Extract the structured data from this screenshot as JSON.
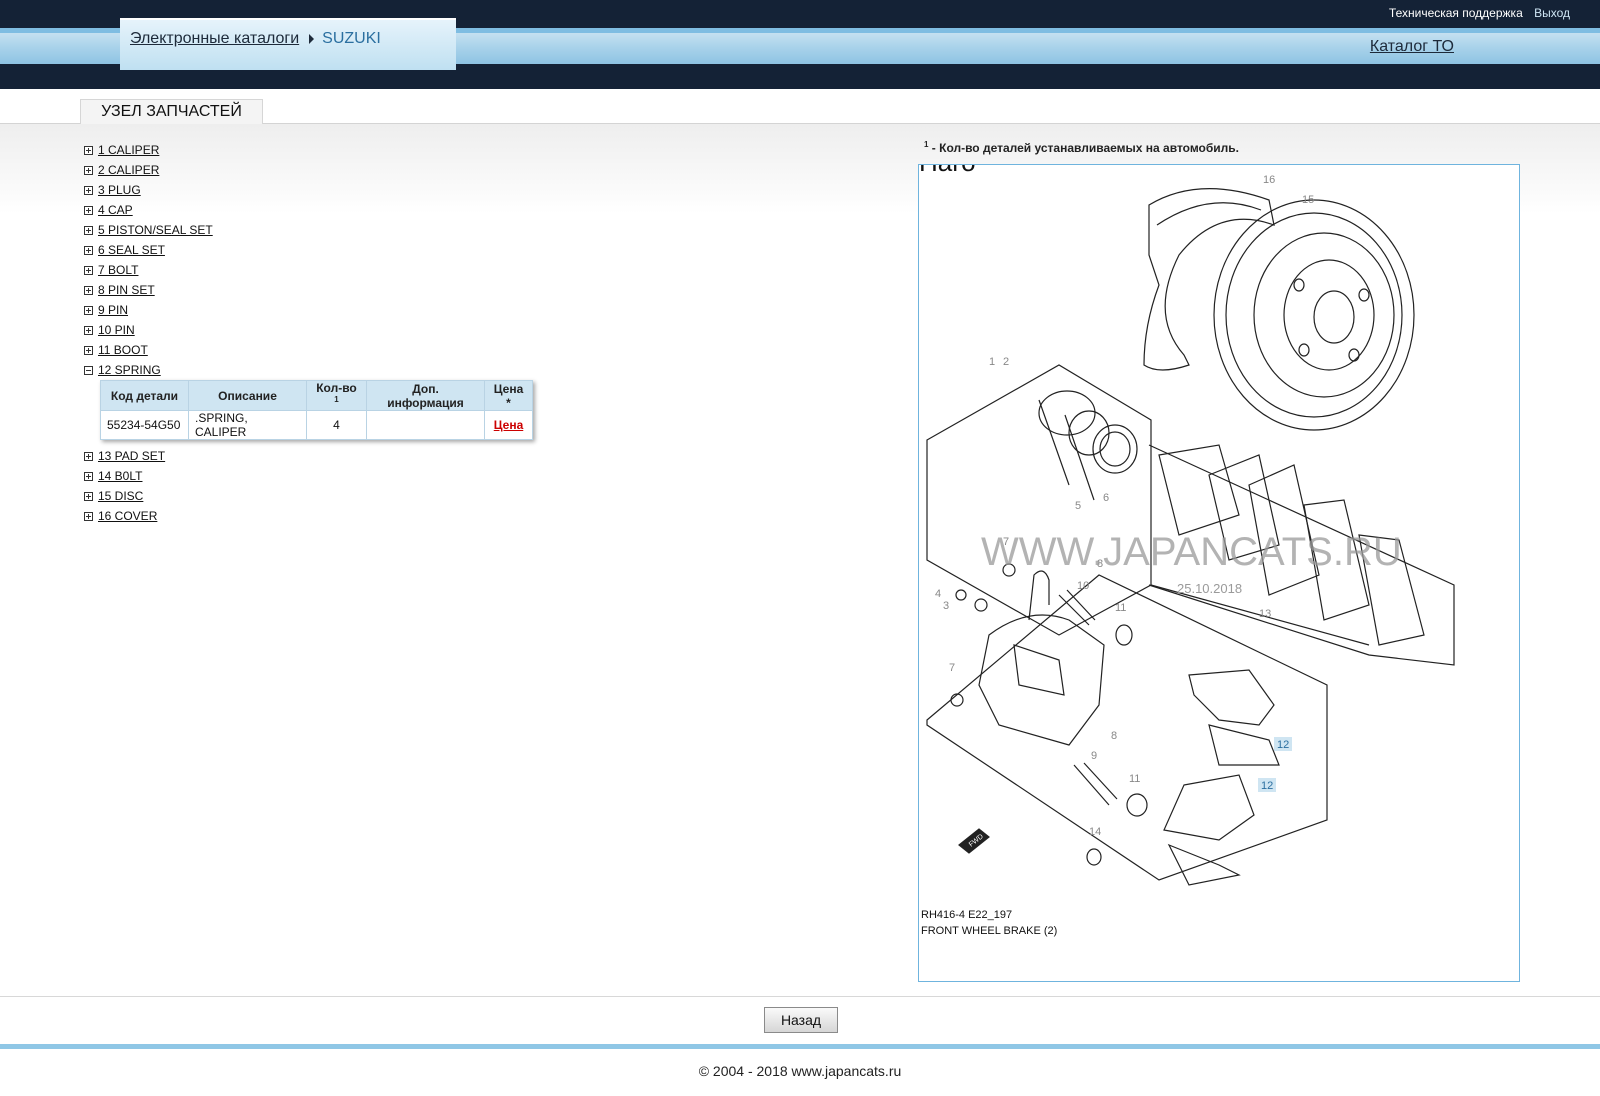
{
  "header": {
    "breadcrumb": {
      "catalogs": "Электронные каталоги",
      "brand": "SUZUKI"
    },
    "support": "Техническая поддержка",
    "exit": "Выход",
    "catalog_to": "Каталог ТО"
  },
  "tab": {
    "label": "УЗЕЛ ЗАПЧАСТЕЙ"
  },
  "tree": {
    "nodes": [
      "1 CALIPER",
      "2 CALIPER",
      "3 PLUG",
      "4 CAP",
      "5 PISTON/SEAL SET",
      "6 SEAL SET",
      "7 BOLT",
      "8 PIN SET",
      "9 PIN",
      "10 PIN",
      "11 BOOT",
      "12 SPRING",
      "13 PAD SET",
      "14 B0LT",
      "15 DISC",
      "16 COVER"
    ],
    "expanded_index": 11
  },
  "detail_table": {
    "headers": {
      "code": "Код детали",
      "desc": "Описание",
      "qty": "Кол-во",
      "qty_sup": "1",
      "info": "Доп. информация",
      "price": "Цена *"
    },
    "row": {
      "code": "55234-54G50",
      "desc": ".SPRING, CALIPER",
      "qty": "4",
      "info": "",
      "price": "Цена"
    }
  },
  "note": {
    "sup": "1",
    "text": " - Кол-во деталей устанавливаемых на автомобиль."
  },
  "diagram": {
    "title_partial": "Наго",
    "watermark": "WWW.JAPANCATS.RU",
    "date": "25.10.2018",
    "caption_code": "RH416-4 E22_197",
    "caption_name": "FRONT WHEEL BRAKE (2)",
    "callouts": [
      "16",
      "15",
      "1",
      "2",
      "5",
      "6",
      "7",
      "8",
      "10",
      "11",
      "4",
      "3",
      "13",
      "7",
      "8",
      "9",
      "11",
      "12",
      "12",
      "14"
    ],
    "fwd": "FWD",
    "highlight_color": "#cfe5f2"
  },
  "footer": {
    "back": "Назад",
    "copyright": "© 2004 - 2018 www.japancats.ru"
  }
}
